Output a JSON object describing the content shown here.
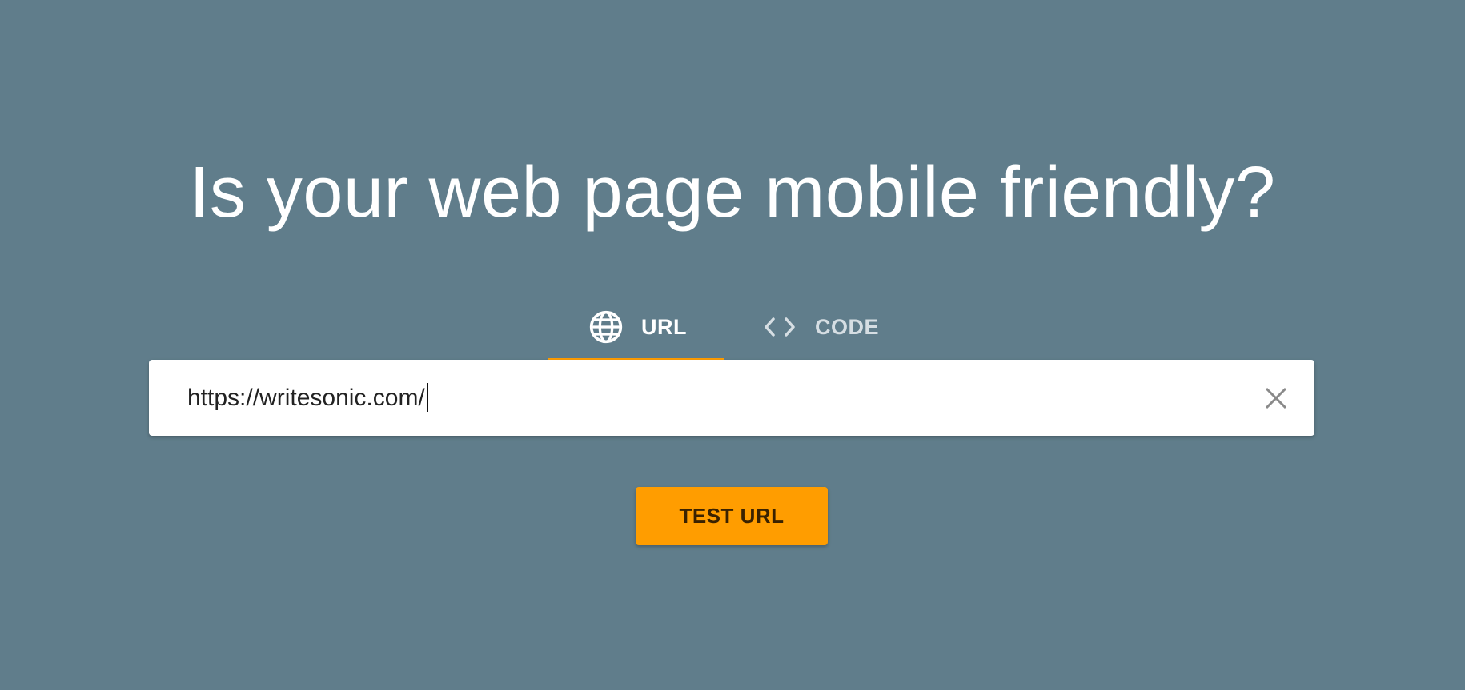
{
  "headline": "Is your web page mobile friendly?",
  "tabs": [
    {
      "label": "URL",
      "icon": "globe-icon",
      "active": true
    },
    {
      "label": "CODE",
      "icon": "code-brackets-icon",
      "active": false
    }
  ],
  "url_input": {
    "value": "https://writesonic.com/",
    "clear_icon": "close-icon"
  },
  "test_button": {
    "label": "TEST URL"
  },
  "colors": {
    "background": "#607d8b",
    "accent": "#ff9d00",
    "input_background": "#ffffff",
    "active_tab_text": "#ffffff",
    "inactive_tab_text": "#d6dee3"
  }
}
